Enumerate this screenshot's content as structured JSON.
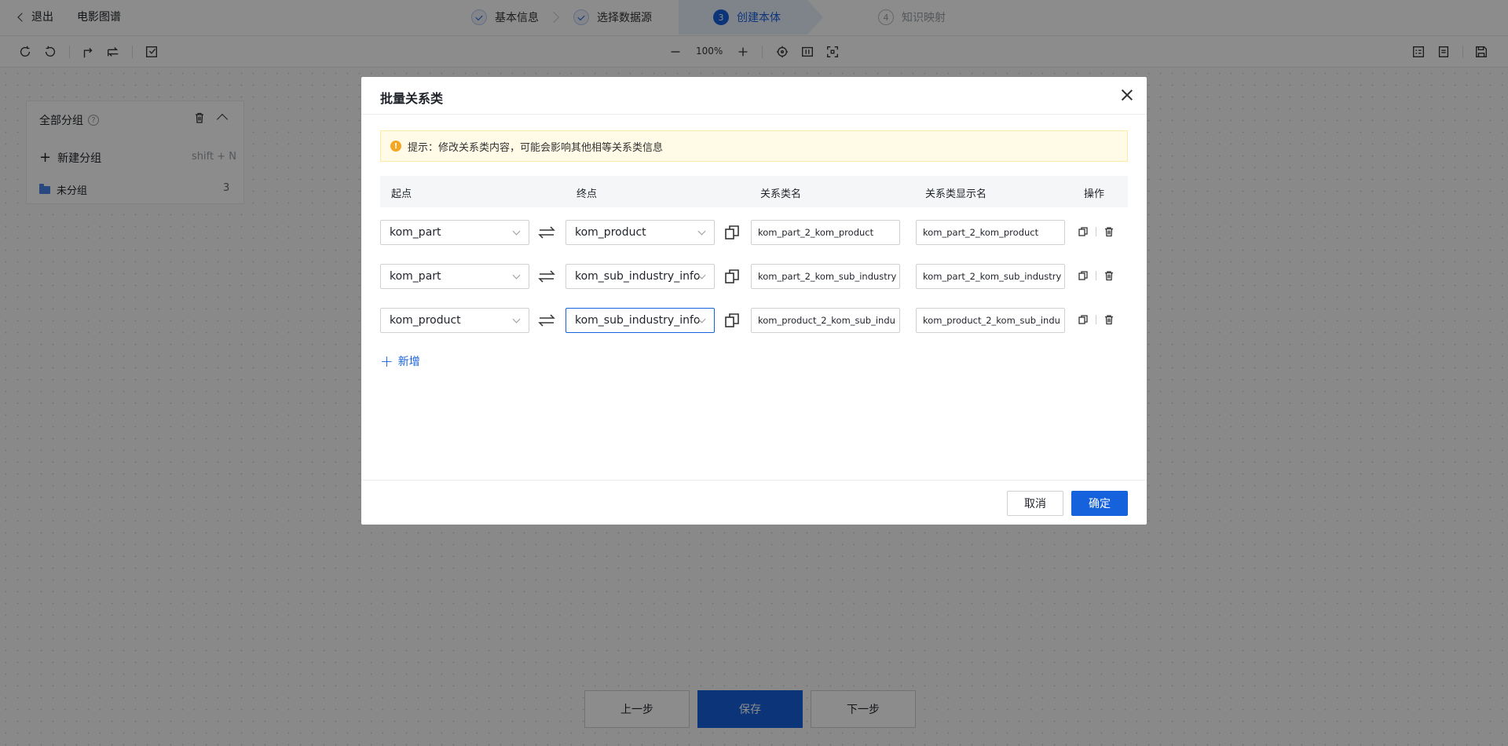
{
  "header": {
    "exit_label": "退出",
    "project_name": "电影图谱",
    "steps": [
      {
        "number": "",
        "label": "基本信息",
        "state": "done"
      },
      {
        "number": "",
        "label": "选择数据源",
        "state": "done"
      },
      {
        "number": "3",
        "label": "创建本体",
        "state": "active"
      },
      {
        "number": "4",
        "label": "知识映射",
        "state": "todo"
      }
    ]
  },
  "toolbar": {
    "zoom_level": "100%",
    "left_icons": [
      "undo-icon",
      "redo-icon",
      "branch-icon",
      "relation-icon",
      "import-icon"
    ],
    "center_icons": [
      "zoom-out-icon",
      "zoom-in-icon",
      "locate-icon",
      "fit-icon",
      "fullscreen-icon"
    ],
    "right_icons": [
      "checklist-icon",
      "document-icon",
      "save-icon"
    ]
  },
  "group_panel": {
    "title": "全部分组",
    "new_group_label": "新建分组",
    "new_group_shortcut": "shift + N",
    "groups": [
      {
        "name": "未分组",
        "count": "3"
      }
    ]
  },
  "footer": {
    "prev_label": "上一步",
    "save_label": "保存",
    "next_label": "下一步"
  },
  "modal": {
    "title": "批量关系类",
    "tip": "提示：修改关系类内容，可能会影响其他相等关系类信息",
    "columns": {
      "start": "起点",
      "end": "终点",
      "name": "关系类名",
      "display_name": "关系类显示名",
      "actions": "操作"
    },
    "rows": [
      {
        "start": "kom_part",
        "end": "kom_product",
        "name": "kom_part_2_kom_product",
        "display_name": "kom_part_2_kom_product"
      },
      {
        "start": "kom_part",
        "end": "kom_sub_industry_info",
        "name": "kom_part_2_kom_sub_industry",
        "display_name": "kom_part_2_kom_sub_industry"
      },
      {
        "start": "kom_product",
        "end": "kom_sub_industry_info",
        "name": "kom_product_2_kom_sub_indu",
        "display_name": "kom_product_2_kom_sub_indu"
      }
    ],
    "add_label": "新增",
    "cancel_label": "取消",
    "confirm_label": "确定"
  }
}
